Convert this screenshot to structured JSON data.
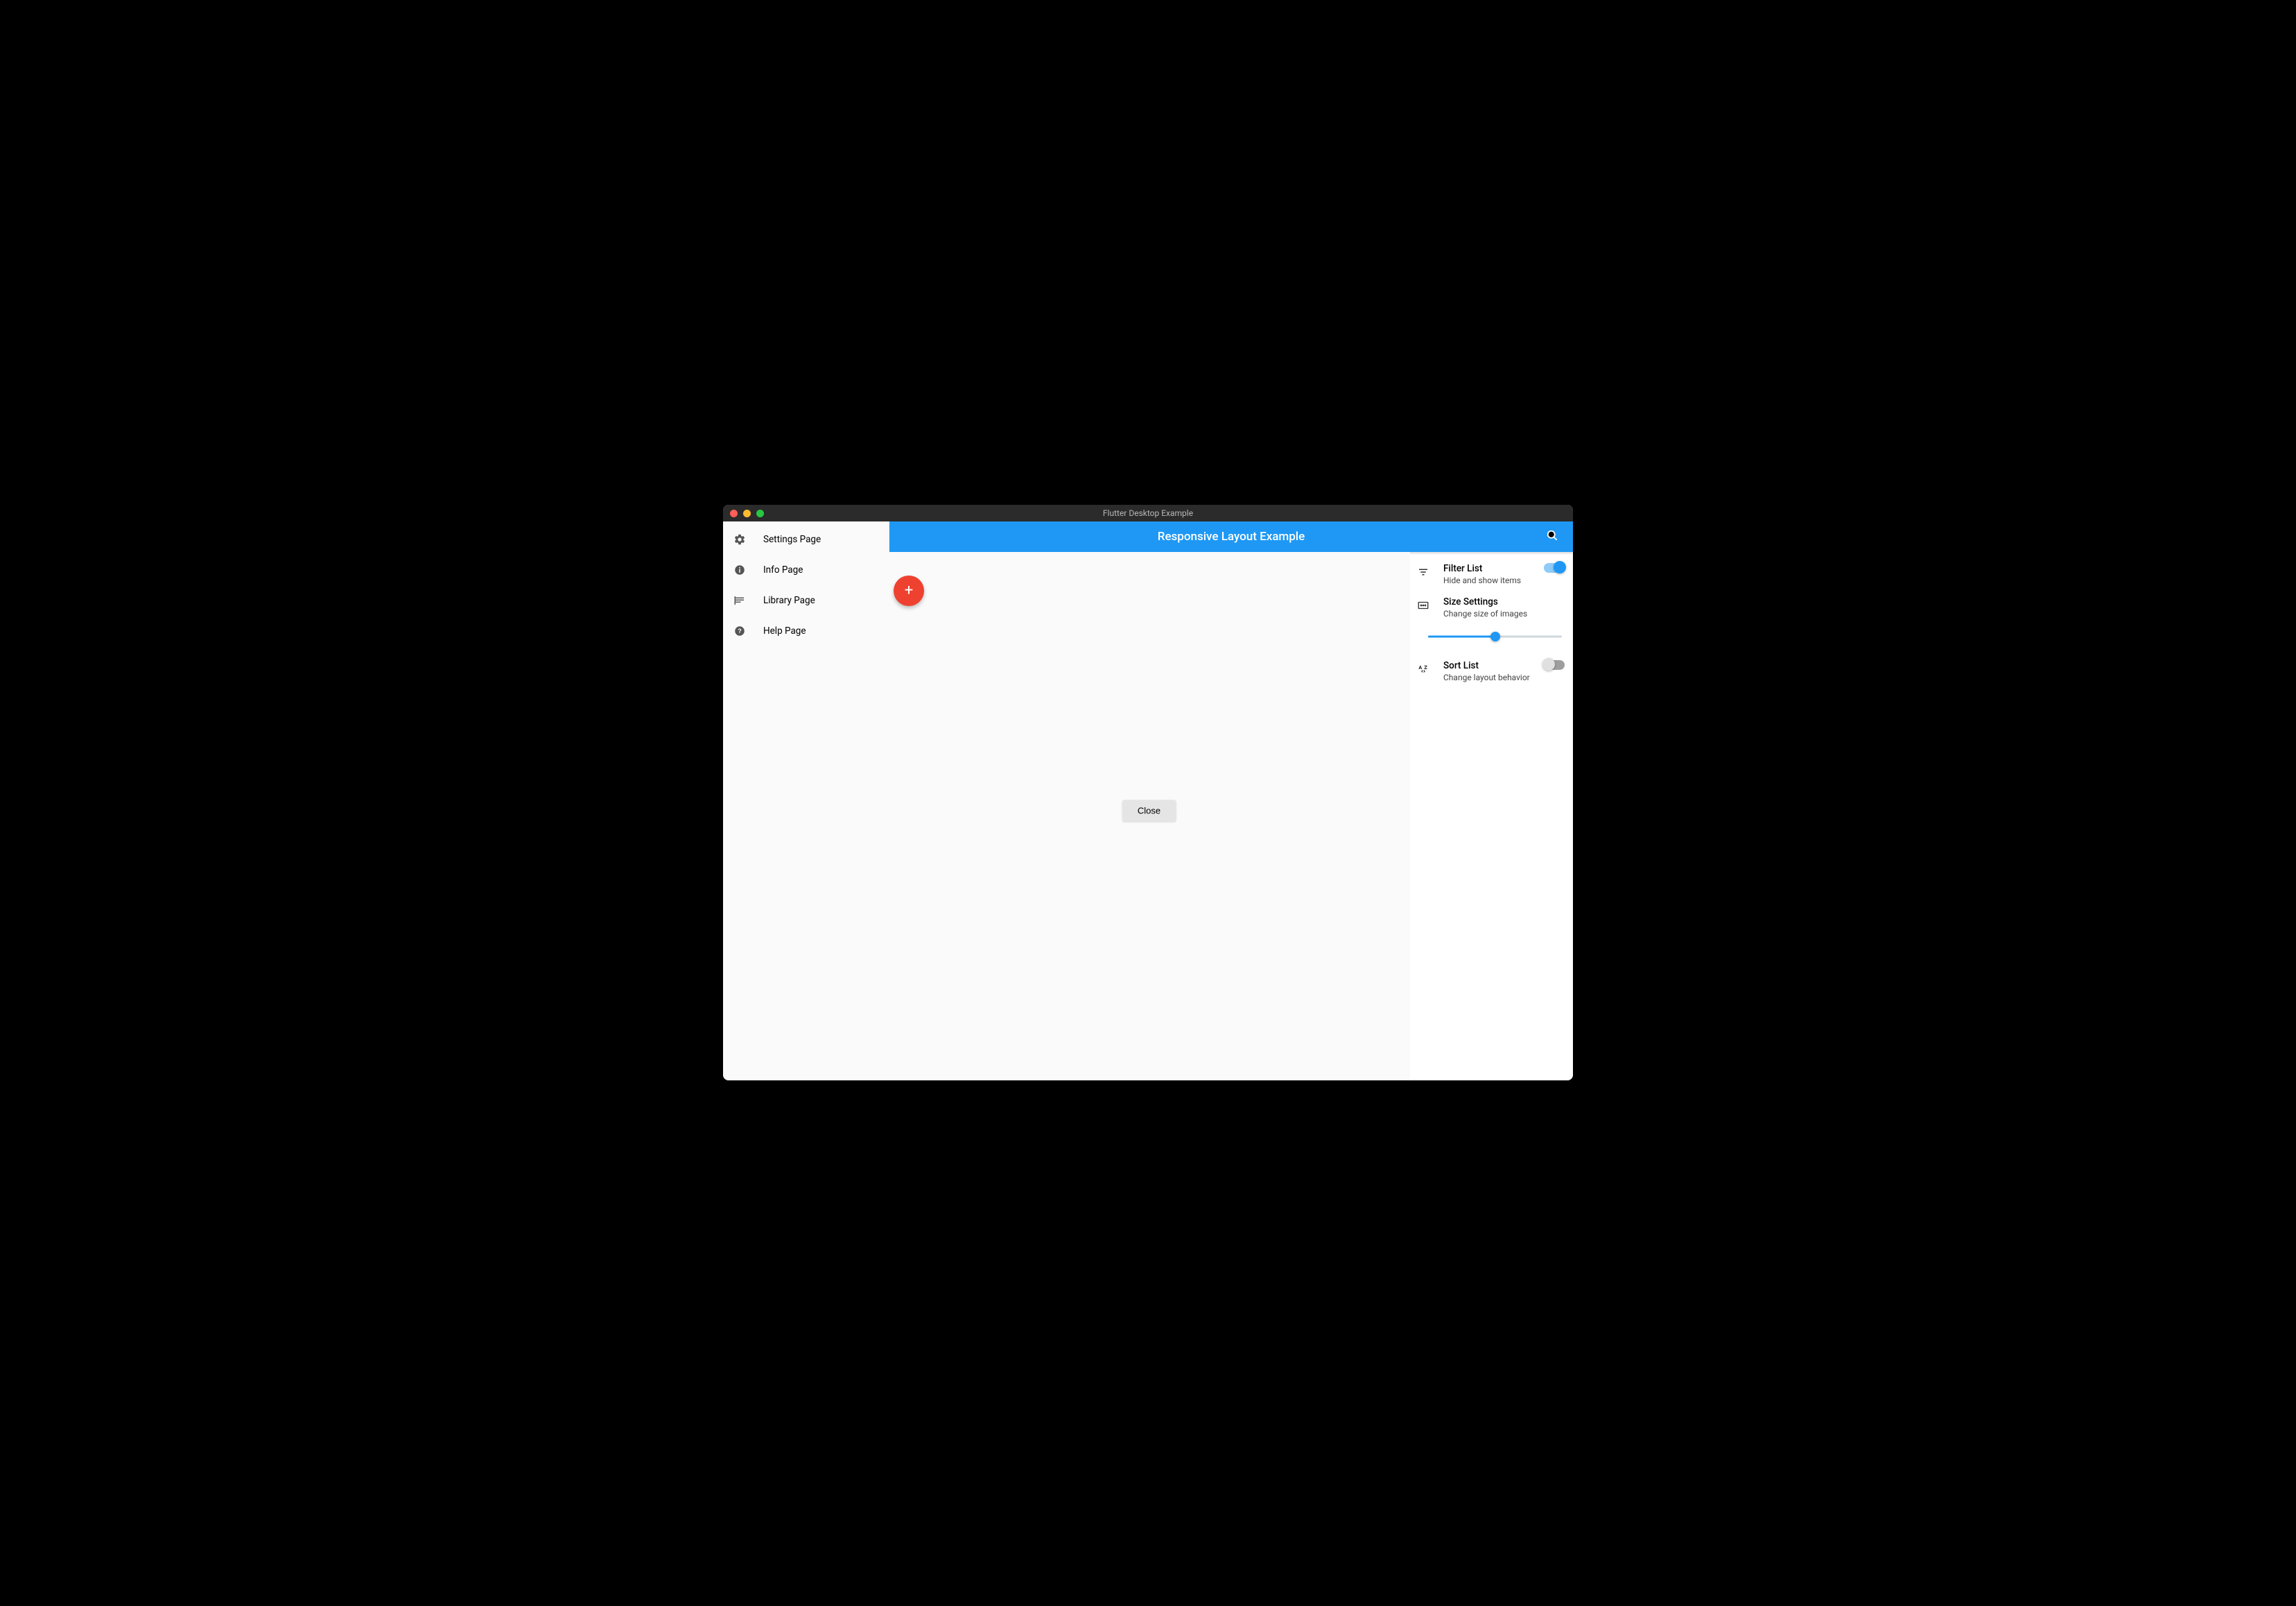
{
  "window": {
    "title": "Flutter Desktop Example"
  },
  "sidebar": {
    "items": [
      {
        "icon": "gear-icon",
        "label": "Settings Page"
      },
      {
        "icon": "info-icon",
        "label": "Info Page"
      },
      {
        "icon": "library-icon",
        "label": "Library Page"
      },
      {
        "icon": "help-icon",
        "label": "Help Page"
      }
    ]
  },
  "appbar": {
    "title": "Responsive Layout Example"
  },
  "fab": {
    "glyph": "+"
  },
  "center": {
    "close_label": "Close"
  },
  "right_panel": {
    "filter": {
      "title": "Filter List",
      "subtitle": "Hide and show items",
      "on": true
    },
    "size": {
      "title": "Size Settings",
      "subtitle": "Change size of images",
      "slider_percent": 50
    },
    "sort": {
      "title": "Sort List",
      "subtitle": "Change layout behavior",
      "on": false
    }
  },
  "colors": {
    "accent": "#1e98f4",
    "fab": "#ef412f"
  }
}
